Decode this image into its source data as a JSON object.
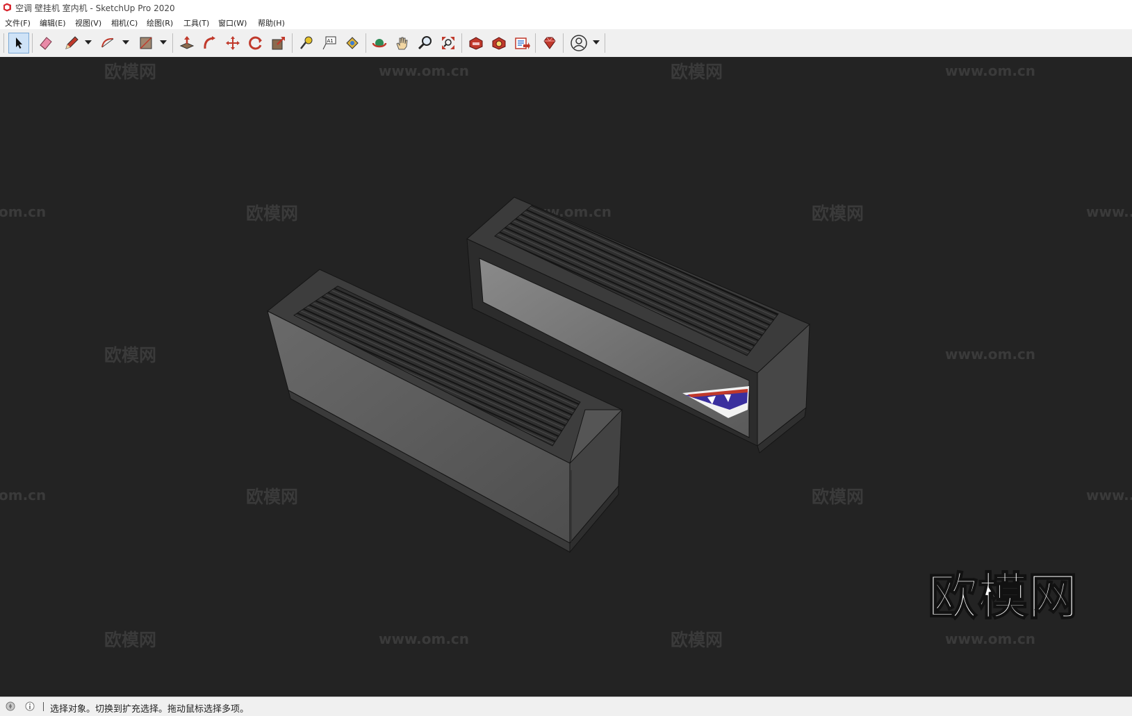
{
  "window": {
    "title": "空调 壁挂机 室内机 - SketchUp Pro 2020"
  },
  "menu": [
    "文件(F)",
    "编辑(E)",
    "视图(V)",
    "相机(C)",
    "绘图(R)",
    "工具(T)",
    "窗口(W)",
    "帮助(H)"
  ],
  "toolbar": {
    "tools": [
      "select-tool",
      "eraser-tool",
      "pencil-tool",
      "arc-tool",
      "rectangle-tool",
      "push-pull-tool",
      "follow-me-tool",
      "move-tool",
      "rotate-tool",
      "scale-tool",
      "tape-measure-tool",
      "text-tool",
      "paint-bucket-tool",
      "orbit-tool",
      "pan-tool",
      "zoom-tool",
      "zoom-extents-tool",
      "warehouse-tool",
      "extension-warehouse-tool",
      "layout-tool",
      "ruby-tool",
      "account-tool"
    ],
    "active_tool": "select-tool",
    "text_tool_label": "A1"
  },
  "viewport": {
    "background": "#232323",
    "watermark_logo": "欧模网",
    "watermark_url": "www.om.cn",
    "watermark_url_left_crop": "om.cn",
    "watermark_url_right_crop": "www..",
    "big_logo": "欧模网"
  },
  "status": {
    "text": "选择对象。切换到扩充选择。拖动鼠标选择多项。"
  }
}
